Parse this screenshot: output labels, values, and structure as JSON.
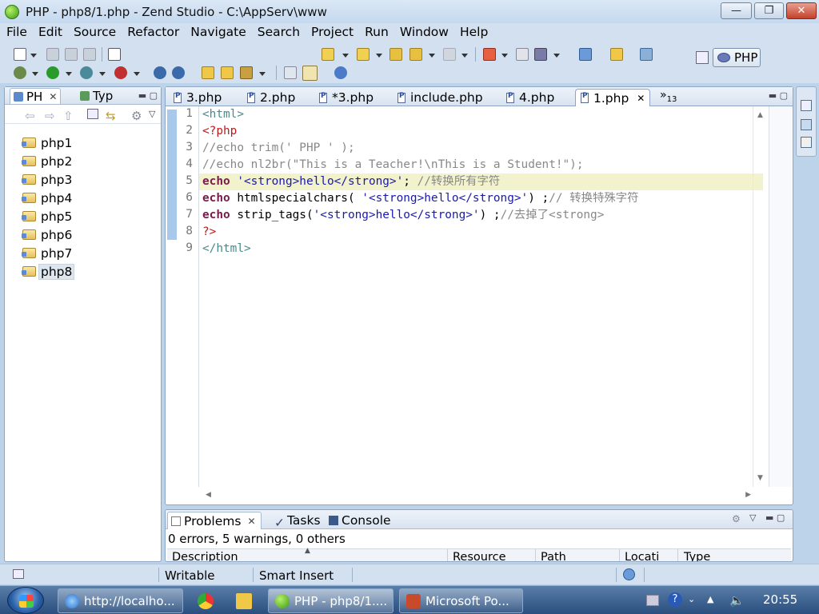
{
  "window": {
    "title": "PHP - php8/1.php - Zend Studio - C:\\AppServ\\www",
    "minimize_label": "—",
    "maximize_label": "❐",
    "close_label": "✕"
  },
  "menu": [
    "File",
    "Edit",
    "Source",
    "Refactor",
    "Navigate",
    "Search",
    "Project",
    "Run",
    "Window",
    "Help"
  ],
  "perspective": {
    "label": "PHP"
  },
  "left_panel": {
    "tabs": [
      "PH",
      "Typ"
    ],
    "projects": [
      "php1",
      "php2",
      "php3",
      "php4",
      "php5",
      "php6",
      "php7",
      "php8"
    ],
    "selected": "php8"
  },
  "editor": {
    "tabs": [
      "3.php",
      "2.php",
      "*3.php",
      "include.php",
      "4.php",
      "1.php"
    ],
    "active_tab": "1.php",
    "overflow_marker": "»",
    "overflow_count": "13",
    "line_numbers": [
      "1",
      "2",
      "3",
      "4",
      "5",
      "6",
      "7",
      "8",
      "9"
    ],
    "lines": [
      [
        {
          "t": "<html>",
          "c": "c-tag"
        }
      ],
      [
        {
          "t": "<?php",
          "c": "c-php"
        }
      ],
      [
        {
          "t": "//echo trim(' PHP ' );",
          "c": "c-com"
        }
      ],
      [
        {
          "t": "//echo nl2br(\"This is a Teacher!\\nThis is a Student!\");",
          "c": "c-com"
        }
      ],
      [
        {
          "t": "echo",
          "c": "c-kw"
        },
        {
          "t": " ",
          "c": "c-plain"
        },
        {
          "t": "'<strong>hello</strong>'",
          "c": "c-str"
        },
        {
          "t": "; ",
          "c": "c-plain"
        },
        {
          "t": "//转换所有字符",
          "c": "c-com"
        }
      ],
      [
        {
          "t": "echo",
          "c": "c-kw"
        },
        {
          "t": " htmlspecialchars( ",
          "c": "c-plain"
        },
        {
          "t": "'<strong>hello</strong>'",
          "c": "c-str"
        },
        {
          "t": ") ;",
          "c": "c-plain"
        },
        {
          "t": "// 转换特殊字符",
          "c": "c-com"
        }
      ],
      [
        {
          "t": "echo",
          "c": "c-kw"
        },
        {
          "t": " strip_tags(",
          "c": "c-plain"
        },
        {
          "t": "'<strong>hello</strong>'",
          "c": "c-str"
        },
        {
          "t": ") ;",
          "c": "c-plain"
        },
        {
          "t": "//去掉了<strong>",
          "c": "c-com"
        }
      ],
      [
        {
          "t": "?>",
          "c": "c-php"
        }
      ],
      [
        {
          "t": "</html>",
          "c": "c-tag"
        }
      ]
    ]
  },
  "bottom_panel": {
    "tabs": [
      "Problems",
      "Tasks",
      "Console"
    ],
    "summary": "0 errors, 5 warnings, 0 others",
    "columns": [
      "Description",
      "Resource",
      "Path",
      "Locati",
      "Type"
    ]
  },
  "statusbar": {
    "mode": "Writable",
    "insert": "Smart Insert"
  },
  "taskbar": {
    "tasks": [
      "http://localho...",
      "PHP - php8/1....",
      "Microsoft Po..."
    ],
    "clock": "20:55"
  }
}
